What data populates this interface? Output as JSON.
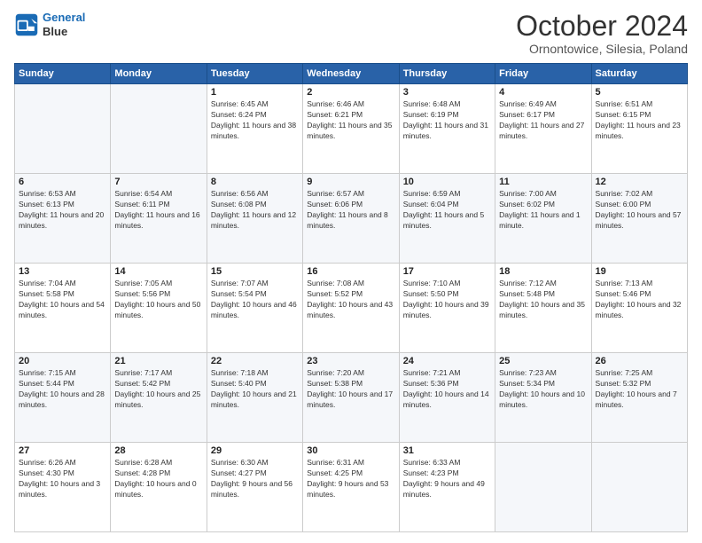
{
  "logo": {
    "line1": "General",
    "line2": "Blue"
  },
  "header": {
    "month": "October 2024",
    "location": "Ornontowice, Silesia, Poland"
  },
  "weekdays": [
    "Sunday",
    "Monday",
    "Tuesday",
    "Wednesday",
    "Thursday",
    "Friday",
    "Saturday"
  ],
  "weeks": [
    [
      {
        "day": "",
        "sunrise": "",
        "sunset": "",
        "daylight": ""
      },
      {
        "day": "",
        "sunrise": "",
        "sunset": "",
        "daylight": ""
      },
      {
        "day": "1",
        "sunrise": "Sunrise: 6:45 AM",
        "sunset": "Sunset: 6:24 PM",
        "daylight": "Daylight: 11 hours and 38 minutes."
      },
      {
        "day": "2",
        "sunrise": "Sunrise: 6:46 AM",
        "sunset": "Sunset: 6:21 PM",
        "daylight": "Daylight: 11 hours and 35 minutes."
      },
      {
        "day": "3",
        "sunrise": "Sunrise: 6:48 AM",
        "sunset": "Sunset: 6:19 PM",
        "daylight": "Daylight: 11 hours and 31 minutes."
      },
      {
        "day": "4",
        "sunrise": "Sunrise: 6:49 AM",
        "sunset": "Sunset: 6:17 PM",
        "daylight": "Daylight: 11 hours and 27 minutes."
      },
      {
        "day": "5",
        "sunrise": "Sunrise: 6:51 AM",
        "sunset": "Sunset: 6:15 PM",
        "daylight": "Daylight: 11 hours and 23 minutes."
      }
    ],
    [
      {
        "day": "6",
        "sunrise": "Sunrise: 6:53 AM",
        "sunset": "Sunset: 6:13 PM",
        "daylight": "Daylight: 11 hours and 20 minutes."
      },
      {
        "day": "7",
        "sunrise": "Sunrise: 6:54 AM",
        "sunset": "Sunset: 6:11 PM",
        "daylight": "Daylight: 11 hours and 16 minutes."
      },
      {
        "day": "8",
        "sunrise": "Sunrise: 6:56 AM",
        "sunset": "Sunset: 6:08 PM",
        "daylight": "Daylight: 11 hours and 12 minutes."
      },
      {
        "day": "9",
        "sunrise": "Sunrise: 6:57 AM",
        "sunset": "Sunset: 6:06 PM",
        "daylight": "Daylight: 11 hours and 8 minutes."
      },
      {
        "day": "10",
        "sunrise": "Sunrise: 6:59 AM",
        "sunset": "Sunset: 6:04 PM",
        "daylight": "Daylight: 11 hours and 5 minutes."
      },
      {
        "day": "11",
        "sunrise": "Sunrise: 7:00 AM",
        "sunset": "Sunset: 6:02 PM",
        "daylight": "Daylight: 11 hours and 1 minute."
      },
      {
        "day": "12",
        "sunrise": "Sunrise: 7:02 AM",
        "sunset": "Sunset: 6:00 PM",
        "daylight": "Daylight: 10 hours and 57 minutes."
      }
    ],
    [
      {
        "day": "13",
        "sunrise": "Sunrise: 7:04 AM",
        "sunset": "Sunset: 5:58 PM",
        "daylight": "Daylight: 10 hours and 54 minutes."
      },
      {
        "day": "14",
        "sunrise": "Sunrise: 7:05 AM",
        "sunset": "Sunset: 5:56 PM",
        "daylight": "Daylight: 10 hours and 50 minutes."
      },
      {
        "day": "15",
        "sunrise": "Sunrise: 7:07 AM",
        "sunset": "Sunset: 5:54 PM",
        "daylight": "Daylight: 10 hours and 46 minutes."
      },
      {
        "day": "16",
        "sunrise": "Sunrise: 7:08 AM",
        "sunset": "Sunset: 5:52 PM",
        "daylight": "Daylight: 10 hours and 43 minutes."
      },
      {
        "day": "17",
        "sunrise": "Sunrise: 7:10 AM",
        "sunset": "Sunset: 5:50 PM",
        "daylight": "Daylight: 10 hours and 39 minutes."
      },
      {
        "day": "18",
        "sunrise": "Sunrise: 7:12 AM",
        "sunset": "Sunset: 5:48 PM",
        "daylight": "Daylight: 10 hours and 35 minutes."
      },
      {
        "day": "19",
        "sunrise": "Sunrise: 7:13 AM",
        "sunset": "Sunset: 5:46 PM",
        "daylight": "Daylight: 10 hours and 32 minutes."
      }
    ],
    [
      {
        "day": "20",
        "sunrise": "Sunrise: 7:15 AM",
        "sunset": "Sunset: 5:44 PM",
        "daylight": "Daylight: 10 hours and 28 minutes."
      },
      {
        "day": "21",
        "sunrise": "Sunrise: 7:17 AM",
        "sunset": "Sunset: 5:42 PM",
        "daylight": "Daylight: 10 hours and 25 minutes."
      },
      {
        "day": "22",
        "sunrise": "Sunrise: 7:18 AM",
        "sunset": "Sunset: 5:40 PM",
        "daylight": "Daylight: 10 hours and 21 minutes."
      },
      {
        "day": "23",
        "sunrise": "Sunrise: 7:20 AM",
        "sunset": "Sunset: 5:38 PM",
        "daylight": "Daylight: 10 hours and 17 minutes."
      },
      {
        "day": "24",
        "sunrise": "Sunrise: 7:21 AM",
        "sunset": "Sunset: 5:36 PM",
        "daylight": "Daylight: 10 hours and 14 minutes."
      },
      {
        "day": "25",
        "sunrise": "Sunrise: 7:23 AM",
        "sunset": "Sunset: 5:34 PM",
        "daylight": "Daylight: 10 hours and 10 minutes."
      },
      {
        "day": "26",
        "sunrise": "Sunrise: 7:25 AM",
        "sunset": "Sunset: 5:32 PM",
        "daylight": "Daylight: 10 hours and 7 minutes."
      }
    ],
    [
      {
        "day": "27",
        "sunrise": "Sunrise: 6:26 AM",
        "sunset": "Sunset: 4:30 PM",
        "daylight": "Daylight: 10 hours and 3 minutes."
      },
      {
        "day": "28",
        "sunrise": "Sunrise: 6:28 AM",
        "sunset": "Sunset: 4:28 PM",
        "daylight": "Daylight: 10 hours and 0 minutes."
      },
      {
        "day": "29",
        "sunrise": "Sunrise: 6:30 AM",
        "sunset": "Sunset: 4:27 PM",
        "daylight": "Daylight: 9 hours and 56 minutes."
      },
      {
        "day": "30",
        "sunrise": "Sunrise: 6:31 AM",
        "sunset": "Sunset: 4:25 PM",
        "daylight": "Daylight: 9 hours and 53 minutes."
      },
      {
        "day": "31",
        "sunrise": "Sunrise: 6:33 AM",
        "sunset": "Sunset: 4:23 PM",
        "daylight": "Daylight: 9 hours and 49 minutes."
      },
      {
        "day": "",
        "sunrise": "",
        "sunset": "",
        "daylight": ""
      },
      {
        "day": "",
        "sunrise": "",
        "sunset": "",
        "daylight": ""
      }
    ]
  ]
}
